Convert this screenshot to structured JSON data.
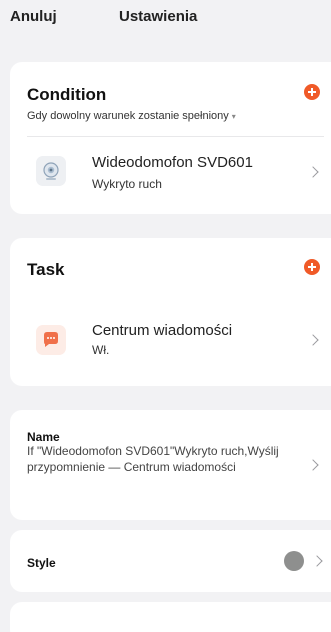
{
  "header": {
    "cancel_label": "Anuluj",
    "title": "Ustawienia"
  },
  "condition": {
    "title": "Condition",
    "subtitle": "Gdy dowolny warunek zostanie spełniony",
    "item": {
      "icon": "camera-icon",
      "title": "Wideodomofon SVD601",
      "subtitle": "Wykryto ruch"
    }
  },
  "task": {
    "title": "Task",
    "item": {
      "icon": "chat-bubble-icon",
      "title": "Centrum wiadomości",
      "subtitle": "Wł."
    }
  },
  "name_row": {
    "label": "Name",
    "value": "If \"Wideodomofon SVD601\"Wykryto ruch,Wyślij przypomnienie — Centrum wiadomości"
  },
  "style_row": {
    "label": "Style",
    "color": "#8e8f8e"
  },
  "colors": {
    "accent": "#f05a28",
    "background": "#f2f2f4"
  }
}
